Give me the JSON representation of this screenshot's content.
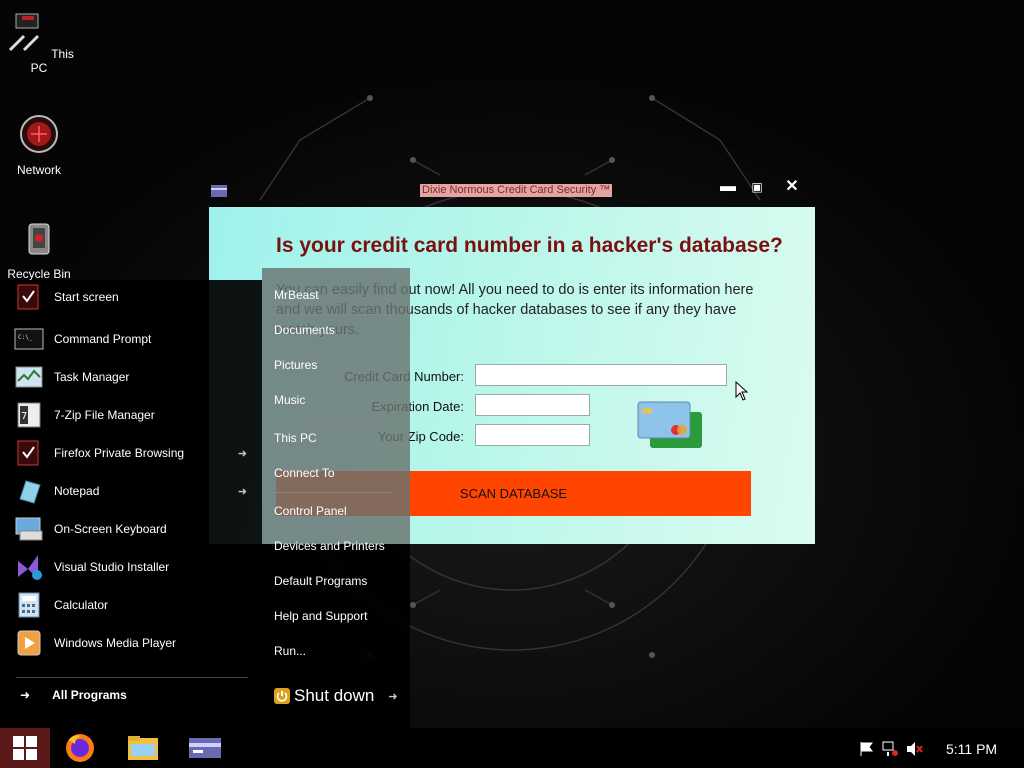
{
  "desktop": {
    "icons": [
      {
        "label": "This PC",
        "icon": "computer-icon"
      },
      {
        "label": "Network",
        "icon": "network-icon"
      },
      {
        "label": "Recycle Bin",
        "icon": "recycle-bin-icon"
      }
    ]
  },
  "popup": {
    "title": "Dixie Normous Credit Card Security ™",
    "headline": "Is your credit card number in a hacker's database?",
    "description": "You can easily find out now! All you need to do is enter its information here and we will scan thousands of hacker databases to see if any they have match yours.",
    "fields": {
      "card_label": "Credit Card Number:",
      "card_value": "",
      "exp_label": "Expiration Date:",
      "exp_value": "",
      "zip_label": "Your Zip Code:",
      "zip_value": ""
    },
    "button": "SCAN DATABASE",
    "accent": "#ff4500"
  },
  "start_menu": {
    "programs": [
      {
        "label": "Start screen",
        "icon": "start-screen-icon",
        "submenu": false
      },
      {
        "label": "Command Prompt",
        "icon": "command-prompt-icon",
        "submenu": false
      },
      {
        "label": "Task Manager",
        "icon": "task-manager-icon",
        "submenu": false
      },
      {
        "label": "7-Zip File Manager",
        "icon": "7zip-icon",
        "submenu": false
      },
      {
        "label": "Firefox Private Browsing",
        "icon": "firefox-private-icon",
        "submenu": true
      },
      {
        "label": "Notepad",
        "icon": "notepad-icon",
        "submenu": true
      },
      {
        "label": "On-Screen Keyboard",
        "icon": "keyboard-icon",
        "submenu": false
      },
      {
        "label": "Visual Studio Installer",
        "icon": "visual-studio-icon",
        "submenu": false
      },
      {
        "label": "Calculator",
        "icon": "calculator-icon",
        "submenu": false
      },
      {
        "label": "Windows Media Player",
        "icon": "media-player-icon",
        "submenu": false
      }
    ],
    "all_programs": "All Programs",
    "places": [
      "MrBeast",
      "Documents",
      "Pictures",
      "Music",
      "This PC",
      "Connect To",
      "Control Panel",
      "Devices and Printers",
      "Default Programs",
      "Help and Support",
      "Run..."
    ],
    "shutdown": "Shut down"
  },
  "taskbar": {
    "pinned": [
      "firefox-icon",
      "file-explorer-icon",
      "credit-card-app-icon"
    ],
    "clock": "5:11 PM"
  }
}
